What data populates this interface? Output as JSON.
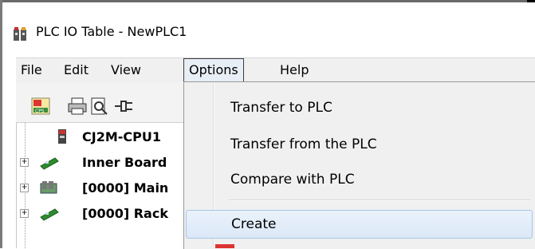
{
  "window": {
    "title": "PLC IO Table - NewPLC1"
  },
  "menu": {
    "items": [
      {
        "label": "File"
      },
      {
        "label": "Edit"
      },
      {
        "label": "View"
      },
      {
        "label": "Options",
        "open": true
      },
      {
        "label": "Help"
      }
    ]
  },
  "toolbar": {
    "buttons": [
      {
        "icon": "cps-icon"
      },
      {
        "icon": "printer-icon"
      },
      {
        "icon": "print-preview-icon"
      },
      {
        "icon": "pin-icon"
      }
    ]
  },
  "tree": {
    "items": [
      {
        "label": "CJ2M-CPU1",
        "icon": "cpu-icon"
      },
      {
        "label": "Inner Board",
        "icon": "board-icon"
      },
      {
        "label": "[0000] Main",
        "icon": "rack-icon"
      },
      {
        "label": "[0000] Rack",
        "icon": "board-icon"
      }
    ]
  },
  "options_menu": {
    "items": [
      {
        "label": "Transfer to PLC"
      },
      {
        "label": "Transfer from the PLC"
      },
      {
        "label": "Compare with PLC"
      },
      {
        "label": "Create",
        "highlighted": true
      }
    ]
  },
  "colors": {
    "menubar_bg": "#f0f0f0",
    "dropdown_bg": "#f0f0f0",
    "hover_border": "#a8c6ea",
    "hover_bg": "#dbe8f7"
  }
}
